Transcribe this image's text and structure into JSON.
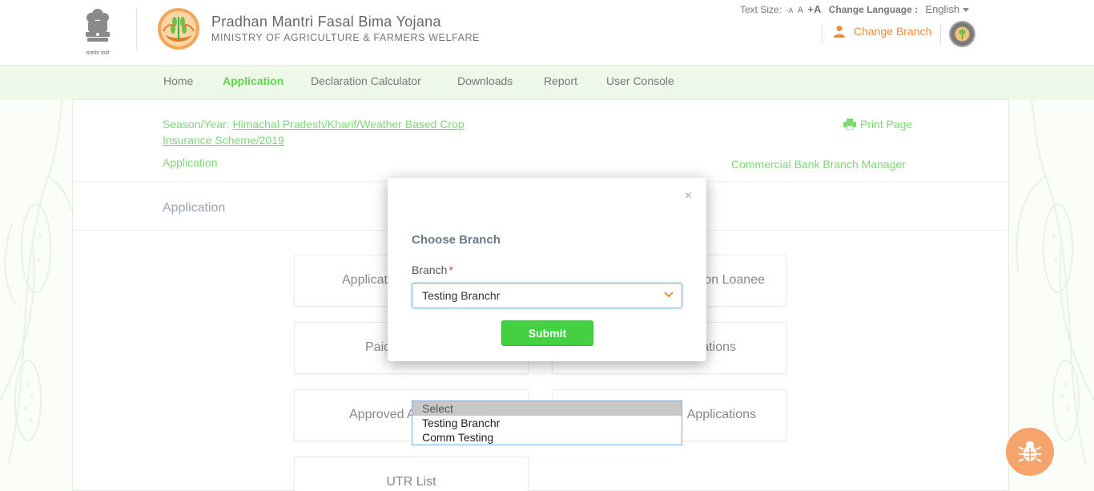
{
  "header": {
    "emblem_caption": "सत्यमेव जयते",
    "title": "Pradhan Mantri Fasal Bima Yojana",
    "subtitle": "MINISTRY OF AGRICULTURE & FARMERS WELFARE",
    "text_size_label": "Text Size:",
    "text_size_small": "-A",
    "text_size_normal": "A",
    "text_size_large": "+A",
    "change_language_label": "Change Language :",
    "language": "English",
    "change_branch": "Change Branch"
  },
  "nav": {
    "items": [
      {
        "label": "Home"
      },
      {
        "label": "Application"
      },
      {
        "label": "Declaration Calculator"
      },
      {
        "label": "Downloads"
      },
      {
        "label": "Report"
      },
      {
        "label": "User Console"
      }
    ],
    "active": "Application"
  },
  "page": {
    "season_label": "Season/Year:",
    "season_value": "Himachal Pradesh/Kharif/Weather Based Crop Insurance Scheme/2019",
    "breadcrumb": "Application",
    "print_page": "Print Page",
    "role": "Commercial Bank Branch Manager",
    "section_title": "Application"
  },
  "tiles": {
    "t1": "Application",
    "t2": "Non Loanee",
    "t3": "Paid Applications",
    "t4": "Applications",
    "t5": "Approved Applications",
    "t6": "Applications",
    "t7": "UTR List"
  },
  "modal": {
    "close": "×",
    "title": "Choose Branch",
    "branch_label": "Branch",
    "required_mark": "*",
    "selected_branch": "Testing Branchr",
    "submit": "Submit"
  },
  "dropdown": {
    "options": [
      "Select",
      "Testing Branchr",
      "Comm Testing"
    ]
  },
  "colors": {
    "accent_green": "#5ed64a",
    "link_green": "#7ed874",
    "orange": "#f08a3e",
    "submit_green": "#43d142"
  }
}
